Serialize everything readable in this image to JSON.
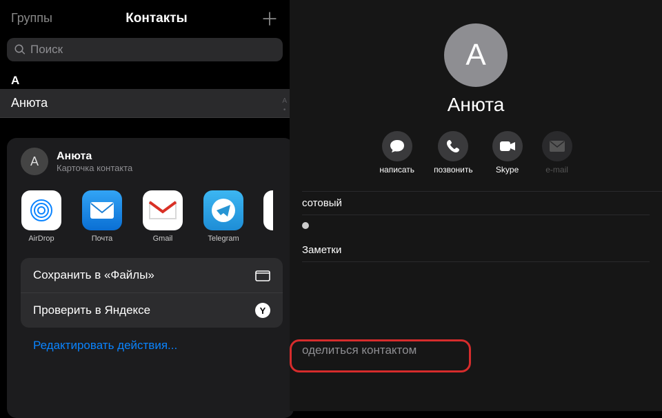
{
  "left": {
    "header": {
      "groups": "Группы",
      "title": "Контакты"
    },
    "search_placeholder": "Поиск",
    "section_letter": "А",
    "contact_row": "Анюта",
    "index_letters": [
      "А",
      "•"
    ]
  },
  "sheet": {
    "avatar_letter": "А",
    "title": "Анюта",
    "subtitle": "Карточка контакта",
    "apps": [
      {
        "label": "AirDrop"
      },
      {
        "label": "Почта"
      },
      {
        "label": "Gmail"
      },
      {
        "label": "Telegram"
      }
    ],
    "action_files": "Сохранить в «Файлы»",
    "action_yandex": "Проверить в Яндексе",
    "yandex_letter": "Y",
    "edit_actions": "Редактировать действия..."
  },
  "card": {
    "avatar_letter": "А",
    "name": "Анюта",
    "comm": [
      {
        "label": "написать"
      },
      {
        "label": "позвонить"
      },
      {
        "label": "Skype"
      },
      {
        "label": "e-mail"
      }
    ],
    "mobile_label": "сотовый",
    "notes_label": "Заметки",
    "share_label": "оделиться контактом"
  }
}
